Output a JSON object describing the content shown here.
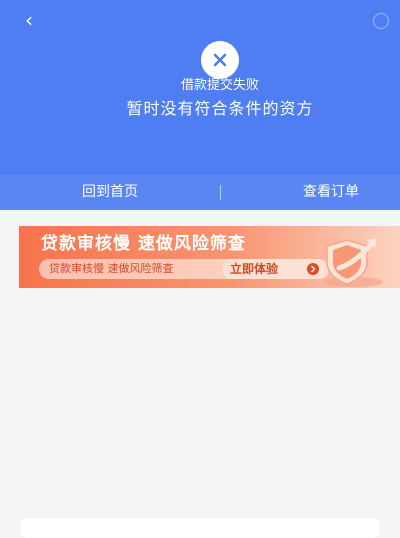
{
  "nav": {
    "back_icon": "‹",
    "help_icon": "help-icon"
  },
  "status": {
    "icon": "close-icon",
    "title": "借款提交失败",
    "subtitle": "暂时没有符合条件的资方"
  },
  "actions": {
    "home_label": "回到首页",
    "orders_label": "查看订单"
  },
  "banner": {
    "title": "贷款审核慢 速做风险筛查",
    "subtitle": "贷款审核慢 速做风险筛查",
    "cta_label": "立即体验",
    "graphic": "shield-arrow-icon"
  },
  "colors": {
    "header": "#4f7df2",
    "actionbar": "#5a86f4",
    "banner_start": "#f7734c",
    "banner_end": "#fcd2bf",
    "background": "#f4f5f7"
  }
}
